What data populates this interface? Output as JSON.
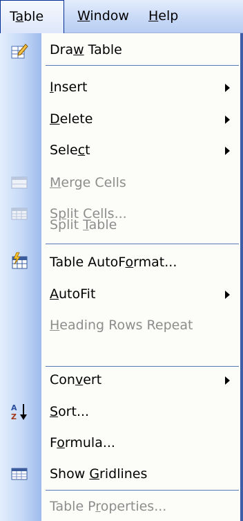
{
  "menubar": {
    "items": [
      {
        "pre": "T",
        "u": "a",
        "post": "ble",
        "active": true
      },
      {
        "pre": "",
        "u": "W",
        "post": "indow",
        "active": false
      },
      {
        "pre": "",
        "u": "H",
        "post": "elp",
        "active": false
      }
    ]
  },
  "menu": {
    "items": [
      {
        "pre": "Dra",
        "u": "w",
        "post": " Table",
        "enabled": true,
        "submenu": false,
        "icon": "draw-table-icon"
      },
      {
        "pre": "",
        "u": "I",
        "post": "nsert",
        "enabled": true,
        "submenu": true,
        "icon": ""
      },
      {
        "pre": "",
        "u": "D",
        "post": "elete",
        "enabled": true,
        "submenu": true,
        "icon": ""
      },
      {
        "pre": "Sele",
        "u": "c",
        "post": "t",
        "enabled": true,
        "submenu": true,
        "icon": ""
      },
      {
        "pre": "",
        "u": "M",
        "post": "erge Cells",
        "enabled": false,
        "submenu": false,
        "icon": "merge-cells-icon"
      },
      {
        "pre": "S",
        "u": "p",
        "post": "lit Cells...",
        "enabled": false,
        "submenu": false,
        "icon": "split-cells-icon"
      },
      {
        "pre": "Split ",
        "u": "T",
        "post": "able",
        "enabled": false,
        "submenu": false,
        "icon": ""
      },
      {
        "pre": "Table AutoF",
        "u": "o",
        "post": "rmat...",
        "enabled": true,
        "submenu": false,
        "icon": "table-autoformat-icon"
      },
      {
        "pre": "",
        "u": "A",
        "post": "utoFit",
        "enabled": true,
        "submenu": true,
        "icon": ""
      },
      {
        "pre": "",
        "u": "H",
        "post": "eading Rows Repeat",
        "enabled": false,
        "submenu": false,
        "icon": ""
      },
      {
        "pre": "Con",
        "u": "v",
        "post": "ert",
        "enabled": true,
        "submenu": true,
        "icon": ""
      },
      {
        "pre": "",
        "u": "S",
        "post": "ort...",
        "enabled": true,
        "submenu": false,
        "icon": "sort-ascending-icon"
      },
      {
        "pre": "F",
        "u": "o",
        "post": "rmula...",
        "enabled": true,
        "submenu": false,
        "icon": ""
      },
      {
        "pre": "Show ",
        "u": "G",
        "post": "ridlines",
        "enabled": true,
        "submenu": false,
        "icon": "show-gridlines-icon"
      },
      {
        "pre": "Table P",
        "u": "r",
        "post": "operties...",
        "enabled": false,
        "submenu": false,
        "icon": ""
      }
    ]
  },
  "colors": {
    "menubar_bg": "#c9daf7",
    "gutter": "#c4d8f6",
    "menu_bg": "#fcfcf9",
    "separator": "#5877b6",
    "disabled_text": "#8d8d8d",
    "border": "#002d96"
  }
}
